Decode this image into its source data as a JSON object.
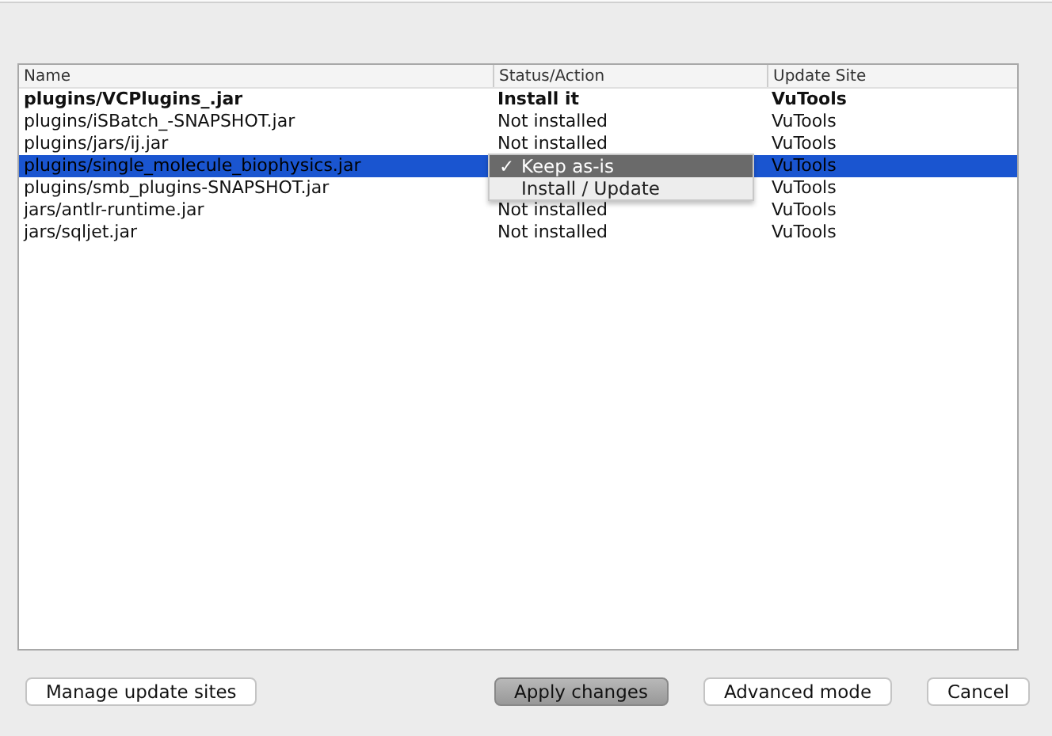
{
  "table": {
    "columns": [
      "Name",
      "Status/Action",
      "Update Site"
    ],
    "rows": [
      {
        "name": "plugins/VCPlugins_.jar",
        "status": "Install it",
        "site": "VuTools",
        "changed": true,
        "selected": false
      },
      {
        "name": "plugins/iSBatch_-SNAPSHOT.jar",
        "status": "Not installed",
        "site": "VuTools",
        "changed": false,
        "selected": false
      },
      {
        "name": "plugins/jars/ij.jar",
        "status": "Not installed",
        "site": "VuTools",
        "changed": false,
        "selected": false
      },
      {
        "name": "plugins/single_molecule_biophysics.jar",
        "site": "VuTools",
        "changed": false,
        "selected": true
      },
      {
        "name": "plugins/smb_plugins-SNAPSHOT.jar",
        "site": "VuTools",
        "changed": false,
        "selected": false
      },
      {
        "name": "jars/antlr-runtime.jar",
        "status": "Not installed",
        "site": "VuTools",
        "changed": false,
        "selected": false
      },
      {
        "name": "jars/sqljet.jar",
        "status": "Not installed",
        "site": "VuTools",
        "changed": false,
        "selected": false
      }
    ]
  },
  "popup_menu": [
    {
      "check": "✓",
      "label": "Keep as-is",
      "selected": true
    },
    {
      "label": "Install / Update",
      "selected": false
    }
  ],
  "buttons": [
    {
      "label": "Manage update sites",
      "default": false
    },
    {
      "label": "Apply changes",
      "default": true
    },
    {
      "label": "Advanced mode",
      "default": false
    },
    {
      "label": "Cancel",
      "default": false
    }
  ]
}
